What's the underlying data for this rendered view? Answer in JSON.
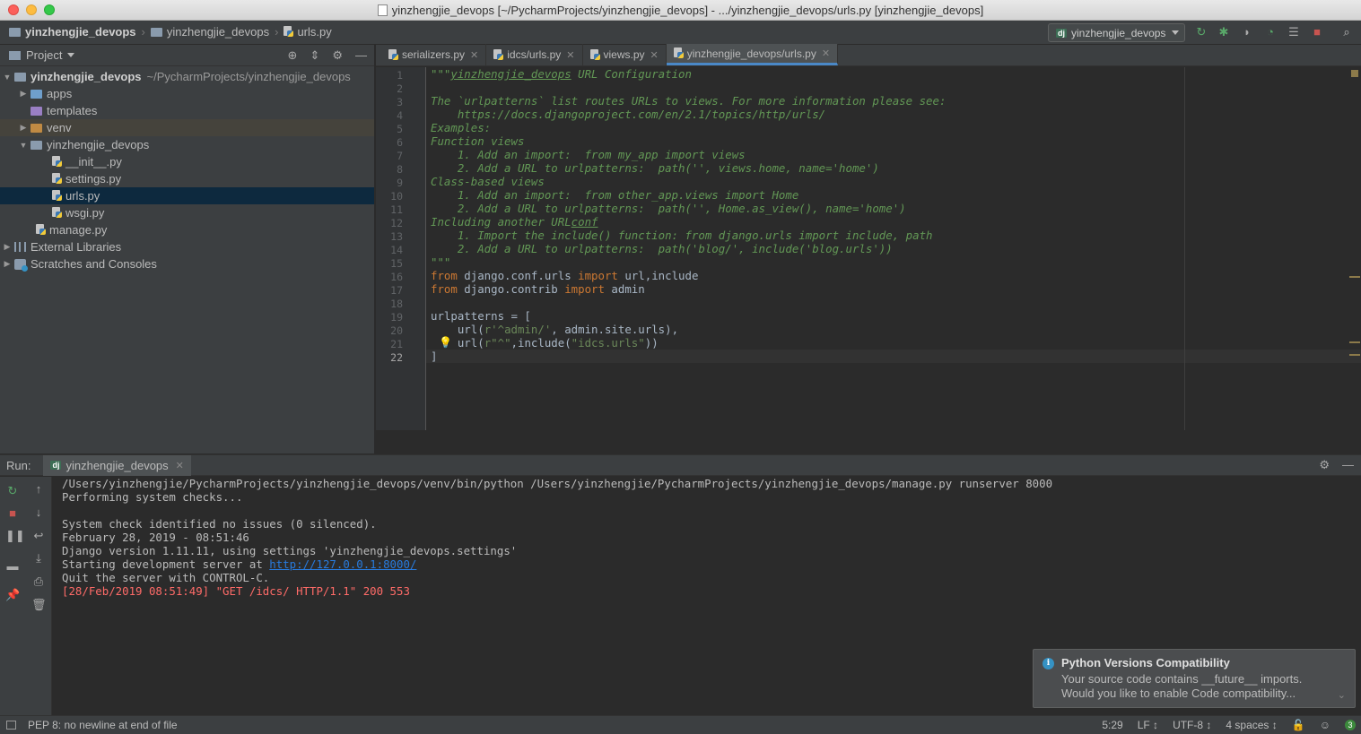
{
  "window": {
    "title": "yinzhengjie_devops [~/PycharmProjects/yinzhengjie_devops] - .../yinzhengjie_devops/urls.py [yinzhengjie_devops]"
  },
  "navbar": {
    "crumbs": [
      "yinzhengjie_devops",
      "yinzhengjie_devops",
      "urls.py"
    ],
    "run_config": "yinzhengjie_devops"
  },
  "project": {
    "header": "Project",
    "tree": [
      {
        "label": "yinzhengjie_devops",
        "path": "~/PycharmProjects/yinzhengjie_devops"
      },
      {
        "label": "apps"
      },
      {
        "label": "templates"
      },
      {
        "label": "venv"
      },
      {
        "label": "yinzhengjie_devops"
      },
      {
        "label": "__init__.py"
      },
      {
        "label": "settings.py"
      },
      {
        "label": "urls.py"
      },
      {
        "label": "wsgi.py"
      },
      {
        "label": "manage.py"
      },
      {
        "label": "External Libraries"
      },
      {
        "label": "Scratches and Consoles"
      }
    ]
  },
  "editor": {
    "tabs": [
      {
        "label": "serializers.py"
      },
      {
        "label": "idcs/urls.py"
      },
      {
        "label": "views.py"
      },
      {
        "label": "yinzhengjie_devops/urls.py"
      }
    ],
    "line_numbers": [
      "1",
      "2",
      "3",
      "4",
      "5",
      "6",
      "7",
      "8",
      "9",
      "10",
      "11",
      "12",
      "13",
      "14",
      "15",
      "16",
      "17",
      "18",
      "19",
      "20",
      "21",
      "22"
    ],
    "lines": [
      {
        "a": "\"\"\"",
        "b": "yinzhengjie_devops",
        "c": " URL Configuration"
      },
      {
        "a": ""
      },
      {
        "a": "The `urlpatterns` list routes URLs to views. For more information please see:"
      },
      {
        "a": "    https://docs.djangoproject.com/en/2.1/topics/http/urls/"
      },
      {
        "a": "Examples:"
      },
      {
        "a": "Function views"
      },
      {
        "a": "    1. Add an import:  from my_app import views"
      },
      {
        "a": "    2. Add a URL to urlpatterns:  path('', views.home, name='home')"
      },
      {
        "a": "Class-based views"
      },
      {
        "a": "    1. Add an import:  from other_app.views import Home"
      },
      {
        "a": "    2. Add a URL to urlpatterns:  path('', Home.as_view(), name='home')"
      },
      {
        "a": "Including another URL",
        "b": "conf"
      },
      {
        "a": "    1. Import the include() function: from django.urls import include, path"
      },
      {
        "a": "    2. Add a URL to urlpatterns:  path('blog/', include('blog.urls'))"
      },
      {
        "a": "\"\"\""
      },
      {
        "kw1": "from",
        "t1": " django.conf.urls ",
        "kw2": "import",
        "t2": " url,include"
      },
      {
        "kw1": "from",
        "t1": " django.contrib ",
        "kw2": "import",
        "t2": " admin"
      },
      {
        "t1": ""
      },
      {
        "t1": "urlpatterns = ["
      },
      {
        "t1": "    url(",
        "s1": "r'^admin/'",
        "t2": ", admin.site.urls),"
      },
      {
        "t1": "    url(",
        "s1": "r\"^\"",
        "t2": ",include(",
        "s2": "\"idcs.urls\"",
        "t3": "))"
      },
      {
        "t1": "]"
      }
    ]
  },
  "run": {
    "label": "Run:",
    "tab": "yinzhengjie_devops",
    "console": [
      {
        "text": "/Users/yinzhengjie/PycharmProjects/yinzhengjie_devops/venv/bin/python /Users/yinzhengjie/PycharmProjects/yinzhengjie_devops/manage.py runserver 8000"
      },
      {
        "text": "Performing system checks..."
      },
      {
        "text": ""
      },
      {
        "text": "System check identified no issues (0 silenced)."
      },
      {
        "text": "February 28, 2019 - 08:51:46"
      },
      {
        "text": "Django version 1.11.11, using settings 'yinzhengjie_devops.settings'"
      },
      {
        "text": "Starting development server at ",
        "link": "http://127.0.0.1:8000/"
      },
      {
        "text": "Quit the server with CONTROL-C."
      },
      {
        "text": "[28/Feb/2019 08:51:49] \"GET /idcs/ HTTP/1.1\" 200 553"
      }
    ]
  },
  "notification": {
    "title": "Python Versions Compatibility",
    "line1": "Your source code contains __future__ imports.",
    "line2": "Would you like to enable Code compatibility..."
  },
  "status": {
    "message": "PEP 8: no newline at end of file",
    "position": "5:29",
    "line_sep": "LF ↕",
    "encoding": "UTF-8 ↕",
    "indent": "4 spaces ↕",
    "events": "3"
  }
}
